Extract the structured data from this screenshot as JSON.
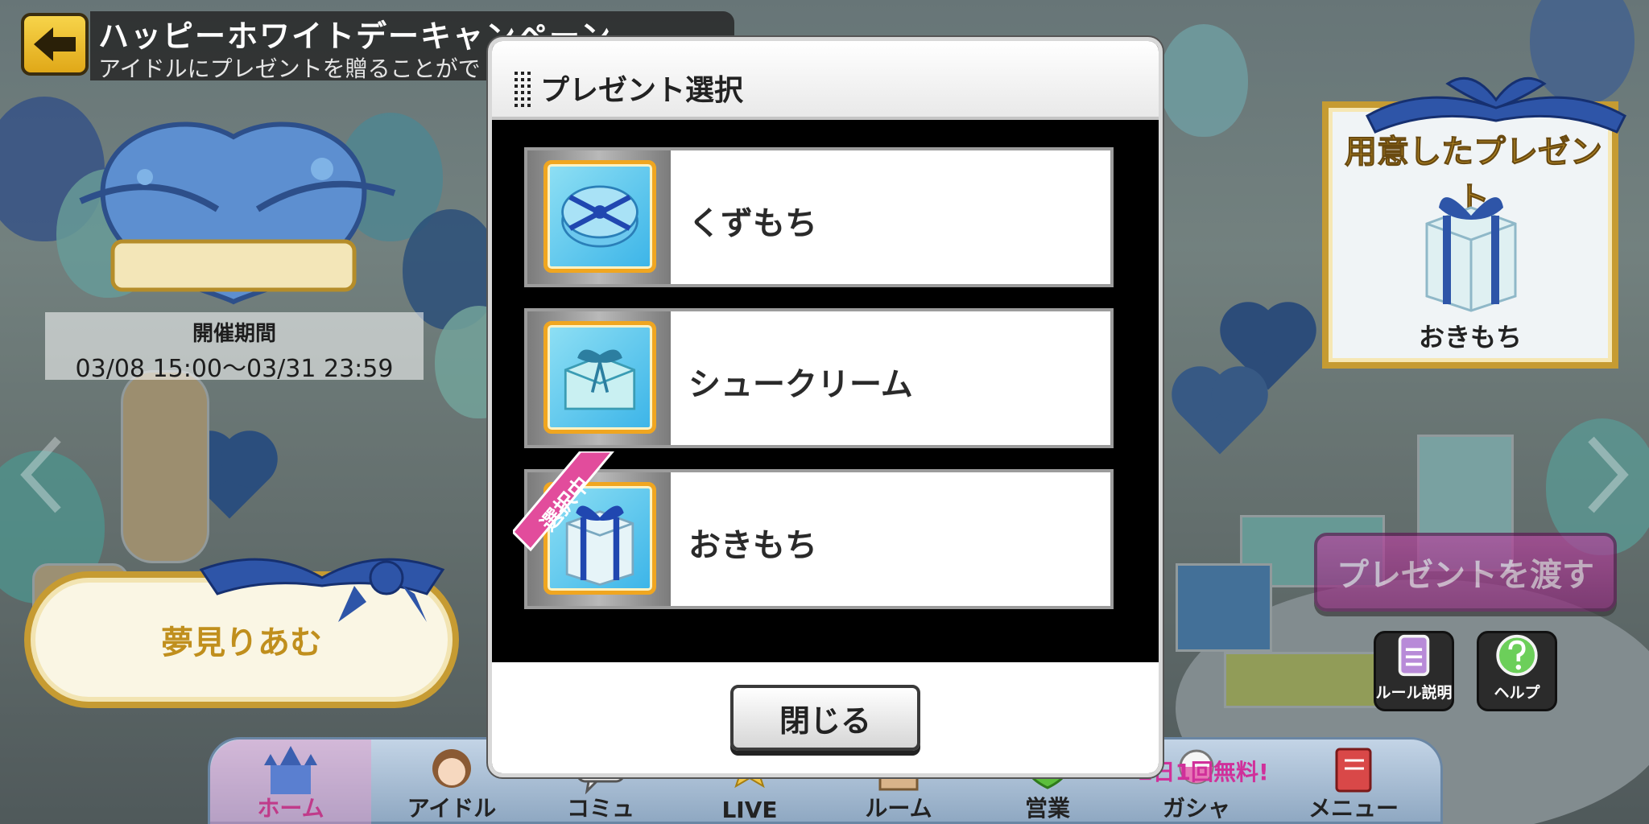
{
  "header": {
    "title": "ハッピーホワイトデーキャンペーン",
    "subtitle": "アイドルにプレゼントを贈ることがで"
  },
  "event": {
    "period_label": "開催期間",
    "period_value": "03/08 15:00〜03/31 23:59",
    "idol_name": "夢見りあむ"
  },
  "prepared": {
    "title": "用意したプレゼント",
    "item_name": "おきもち"
  },
  "actions": {
    "give_label": "プレゼントを渡す",
    "rules_label": "ルール説明",
    "help_label": "ヘルプ"
  },
  "modal": {
    "title": "プレゼント選択",
    "items": [
      {
        "label": "くずもち",
        "icon": "round-gift-box-icon",
        "selected": false
      },
      {
        "label": "シュークリーム",
        "icon": "cream-puff-box-icon",
        "selected": false
      },
      {
        "label": "おきもち",
        "icon": "square-gift-box-icon",
        "selected": true
      }
    ],
    "selected_badge": "選択中",
    "close_label": "閉じる"
  },
  "bottom_nav": {
    "items": [
      {
        "label": "ホーム",
        "icon": "castle-icon"
      },
      {
        "label": "アイドル",
        "icon": "idol-portrait-icon"
      },
      {
        "label": "コミュ",
        "icon": "chat-icon"
      },
      {
        "label": "LIVE",
        "icon": "stage-icon"
      },
      {
        "label": "ルーム",
        "icon": "room-icon"
      },
      {
        "label": "営業",
        "icon": "work-icon"
      },
      {
        "label": "ガシャ",
        "icon": "gacha-icon"
      },
      {
        "label": "メニュー",
        "icon": "menu-book-icon"
      }
    ],
    "gacha_badge": "1日1回無料!"
  },
  "colors": {
    "accent_gold": "#c69b32",
    "give_button": "#9c3688",
    "home_highlight": "#c03b8a"
  }
}
